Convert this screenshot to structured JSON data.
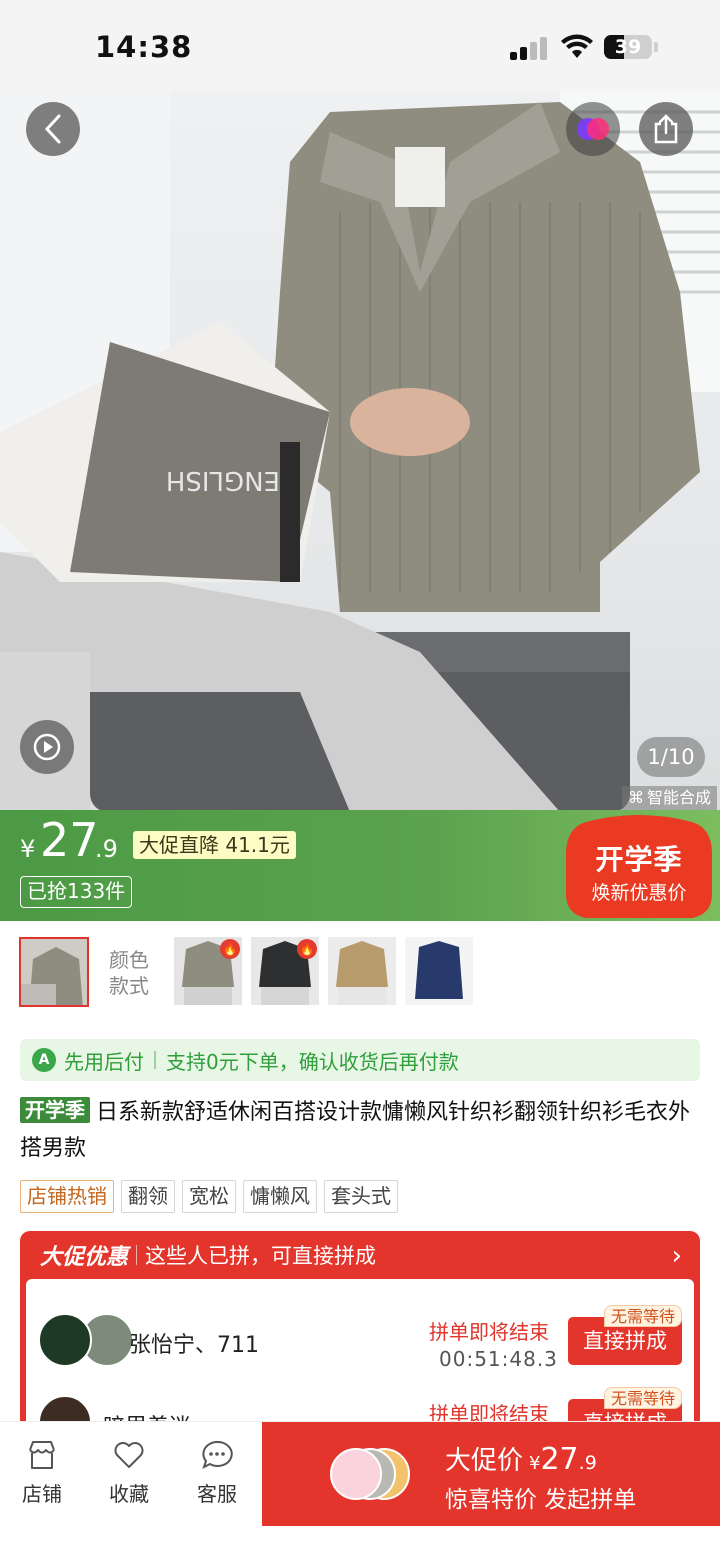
{
  "status": {
    "time": "14:38",
    "battery": "39"
  },
  "hero": {
    "page_counter": "1/10",
    "ai_tag": "智能合成"
  },
  "price": {
    "currency": "¥",
    "integer": "27",
    "decimal": ".9",
    "drop_label": "大促直降 41.1元",
    "sold_label": "已抢133件",
    "season_title": "开学季",
    "season_sub": "焕新优惠价"
  },
  "variants": {
    "label": "颜色\n款式",
    "count": 4
  },
  "paylater": {
    "name": "先用后付",
    "desc": "支持0元下单，确认收货后再付款"
  },
  "product": {
    "tag": "开学季",
    "title": "日系新款舒适休闲百搭设计款慵懒风针织衫翻领针织衫毛衣外搭男款"
  },
  "tags": [
    "店铺热销",
    "翻领",
    "宽松",
    "慵懒风",
    "套头式"
  ],
  "group": {
    "brand": "大促优惠",
    "subtitle": "这些人已拼，可直接拼成",
    "rows": [
      {
        "name": "张怡宁、711",
        "status": "拼单即将结束",
        "timer": "00:51:48.3",
        "button": "直接拼成",
        "badge": "无需等待"
      },
      {
        "name": "暗里着迷",
        "status": "拼单即将结束",
        "timer": "",
        "button": "直接拼成",
        "badge": "无需等待"
      }
    ]
  },
  "bottom": {
    "store": "店铺",
    "favorite": "收藏",
    "service": "客服",
    "buy_title": "大促价",
    "buy_currency": "¥",
    "buy_int": "27",
    "buy_dec": ".9",
    "buy_sub": "惊喜特价 发起拼单"
  },
  "colors": {
    "accent_red": "#e3352b",
    "price_green": "#4c9a45",
    "paylater_green": "#2f9e3b"
  }
}
